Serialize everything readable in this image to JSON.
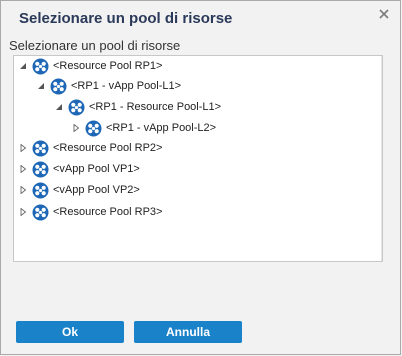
{
  "dialog": {
    "title": "Selezionare un pool di risorse",
    "prompt": "Selezionare un pool di risorse"
  },
  "icons": {
    "close": "close-icon",
    "pool": "resource-pool-icon"
  },
  "tree": [
    {
      "label": "<Resource Pool RP1>",
      "depth": 0,
      "expanded": true
    },
    {
      "label": "<RP1 - vApp Pool-L1>",
      "depth": 1,
      "expanded": true
    },
    {
      "label": "<RP1 - Resource Pool-L1>",
      "depth": 2,
      "expanded": true
    },
    {
      "label": "<RP1 - vApp Pool-L2>",
      "depth": 3,
      "expanded": false
    },
    {
      "label": "<Resource Pool RP2>",
      "depth": 0,
      "expanded": false
    },
    {
      "label": "<vApp Pool VP1>",
      "depth": 0,
      "expanded": false
    },
    {
      "label": "<vApp Pool VP2>",
      "depth": 0,
      "expanded": false
    },
    {
      "label": "<Resource Pool RP3>",
      "depth": 0,
      "expanded": false
    }
  ],
  "buttons": {
    "ok": "Ok",
    "cancel": "Annulla"
  },
  "colors": {
    "accent": "#1a82c8",
    "title": "#2b3a5a",
    "icon": "#1d67b6"
  }
}
